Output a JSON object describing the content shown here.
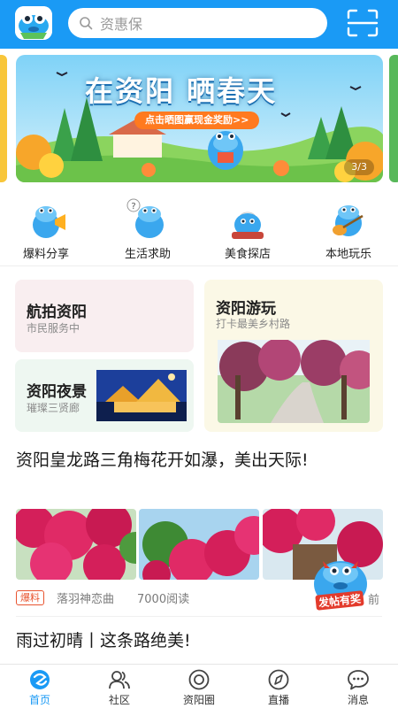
{
  "header": {
    "search_placeholder": "资惠保",
    "logo_icon": "hippo-logo-icon",
    "scan_icon": "scan-icon"
  },
  "banner": {
    "title": "在资阳 晒春天",
    "cta": "点击晒图赢现金奖励>>",
    "counter": "3/3"
  },
  "quick_entries": [
    {
      "label": "爆料分享",
      "icon": "hippo-megaphone-icon"
    },
    {
      "label": "生活求助",
      "icon": "hippo-question-icon"
    },
    {
      "label": "美食探店",
      "icon": "hippo-chef-icon"
    },
    {
      "label": "本地玩乐",
      "icon": "hippo-guitar-icon"
    }
  ],
  "cards": {
    "aerial": {
      "title": "航拍资阳",
      "subtitle": "市民服务中"
    },
    "tour": {
      "title": "资阳游玩",
      "subtitle": "打卡最美乡村路"
    },
    "night": {
      "title": "资阳夜景",
      "subtitle": "璀璨三贤廊"
    }
  },
  "article1": {
    "title": "资阳皇龙路三角梅花开如瀑，美出天际!",
    "tag": "爆料",
    "author": "落羽神恋曲",
    "views": "7000阅读",
    "time": "前"
  },
  "fab": {
    "label": "发帖有奖"
  },
  "article2": {
    "title": "雨过初晴丨这条路绝美!"
  },
  "tabs": [
    {
      "label": "首页",
      "icon": "home-icon",
      "active": true
    },
    {
      "label": "社区",
      "icon": "community-icon",
      "active": false
    },
    {
      "label": "资阳圈",
      "icon": "circle-icon",
      "active": false
    },
    {
      "label": "直播",
      "icon": "live-icon",
      "active": false
    },
    {
      "label": "消息",
      "icon": "message-icon",
      "active": false
    }
  ],
  "colors": {
    "brand": "#1a9af5",
    "tag": "#e8542f",
    "card_pink": "#f9eef0",
    "card_yellow": "#fbf8e6",
    "card_green": "#eef7f1"
  }
}
